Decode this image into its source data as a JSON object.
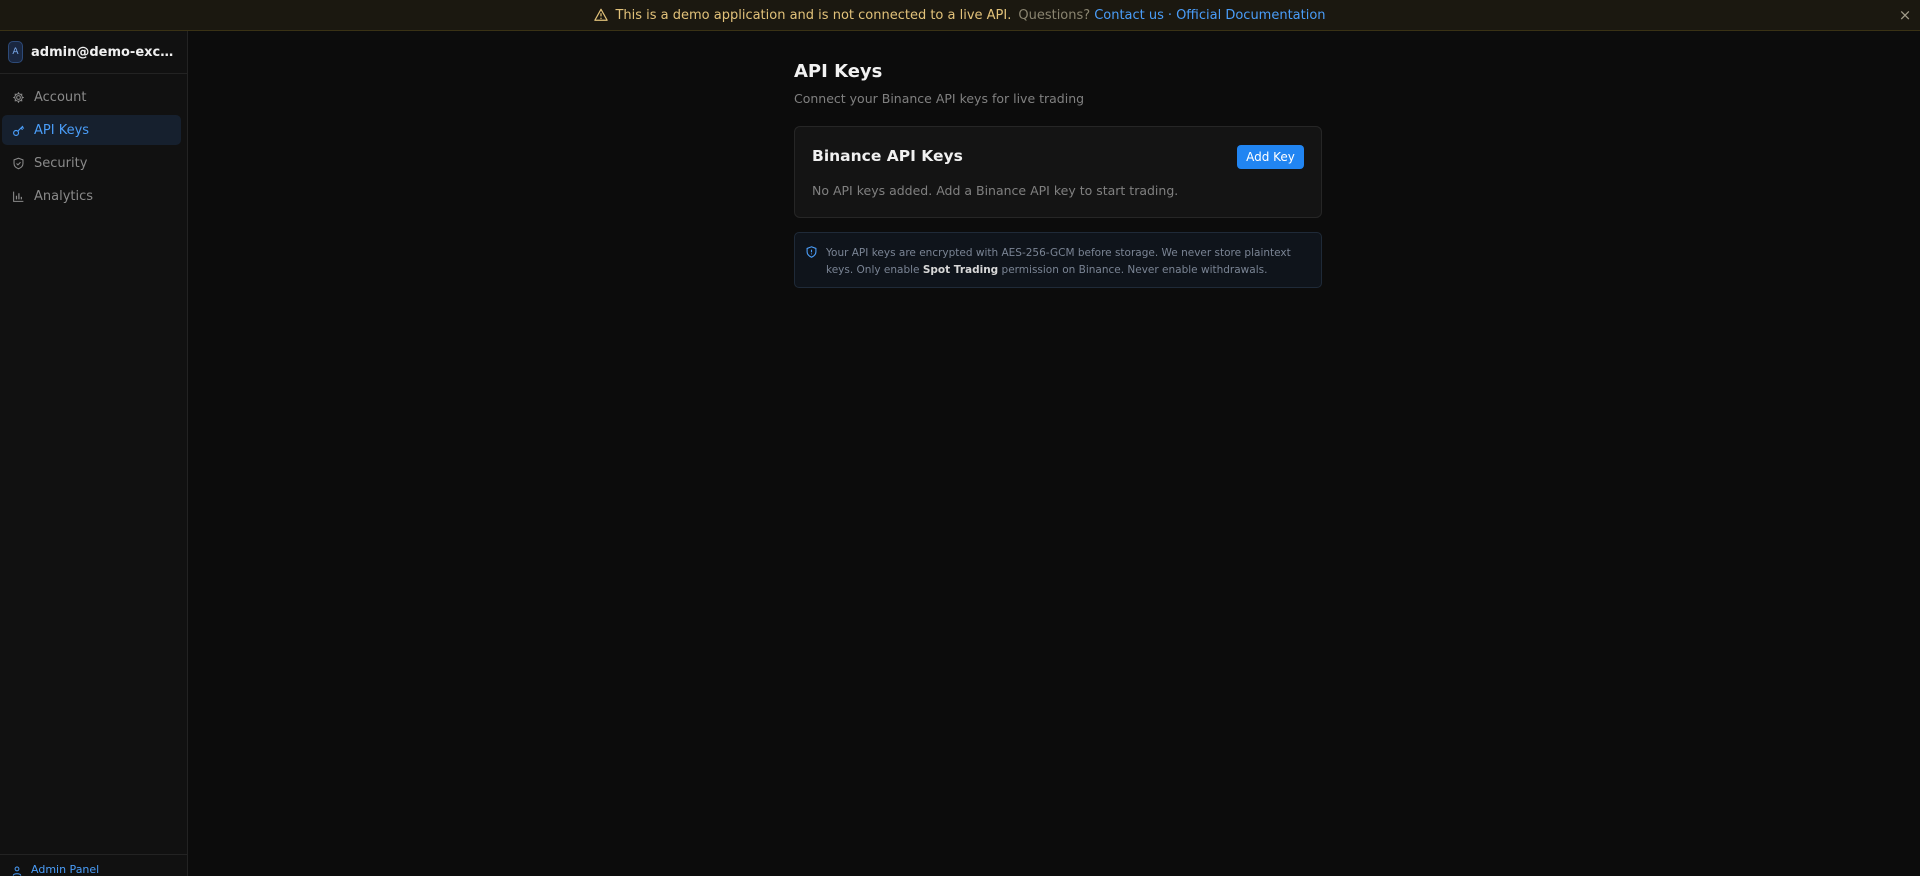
{
  "banner": {
    "message": "This is a demo application and is not connected to a live API.",
    "questions": "Questions?",
    "contact_link": "Contact us",
    "separator": "·",
    "docs_link": "Official Documentation",
    "close": "×"
  },
  "sidebar": {
    "avatar_initial": "A",
    "user_email": "admin@demo-exchange",
    "items": [
      {
        "label": "Account",
        "icon": "gear-icon"
      },
      {
        "label": "API Keys",
        "icon": "key-icon",
        "active": true
      },
      {
        "label": "Security",
        "icon": "shield-icon"
      },
      {
        "label": "Analytics",
        "icon": "bar-chart-icon"
      }
    ],
    "footer_label": "Admin Panel"
  },
  "main": {
    "title": "API Keys",
    "subtitle": "Connect your Binance API keys for live trading",
    "card": {
      "title": "Binance API Keys",
      "add_button": "Add Key",
      "empty_message": "No API keys added. Add a Binance API key to start trading."
    },
    "info": {
      "text_1": "Your API keys are encrypted with AES-256-GCM before storage. We never store plaintext keys. Only enable ",
      "bold": "Spot Trading",
      "text_2": " permission on Binance. Never enable withdrawals."
    }
  },
  "colors": {
    "accent": "#2185f2",
    "banner_text": "#e2c27a",
    "background": "#0c0c0c"
  }
}
